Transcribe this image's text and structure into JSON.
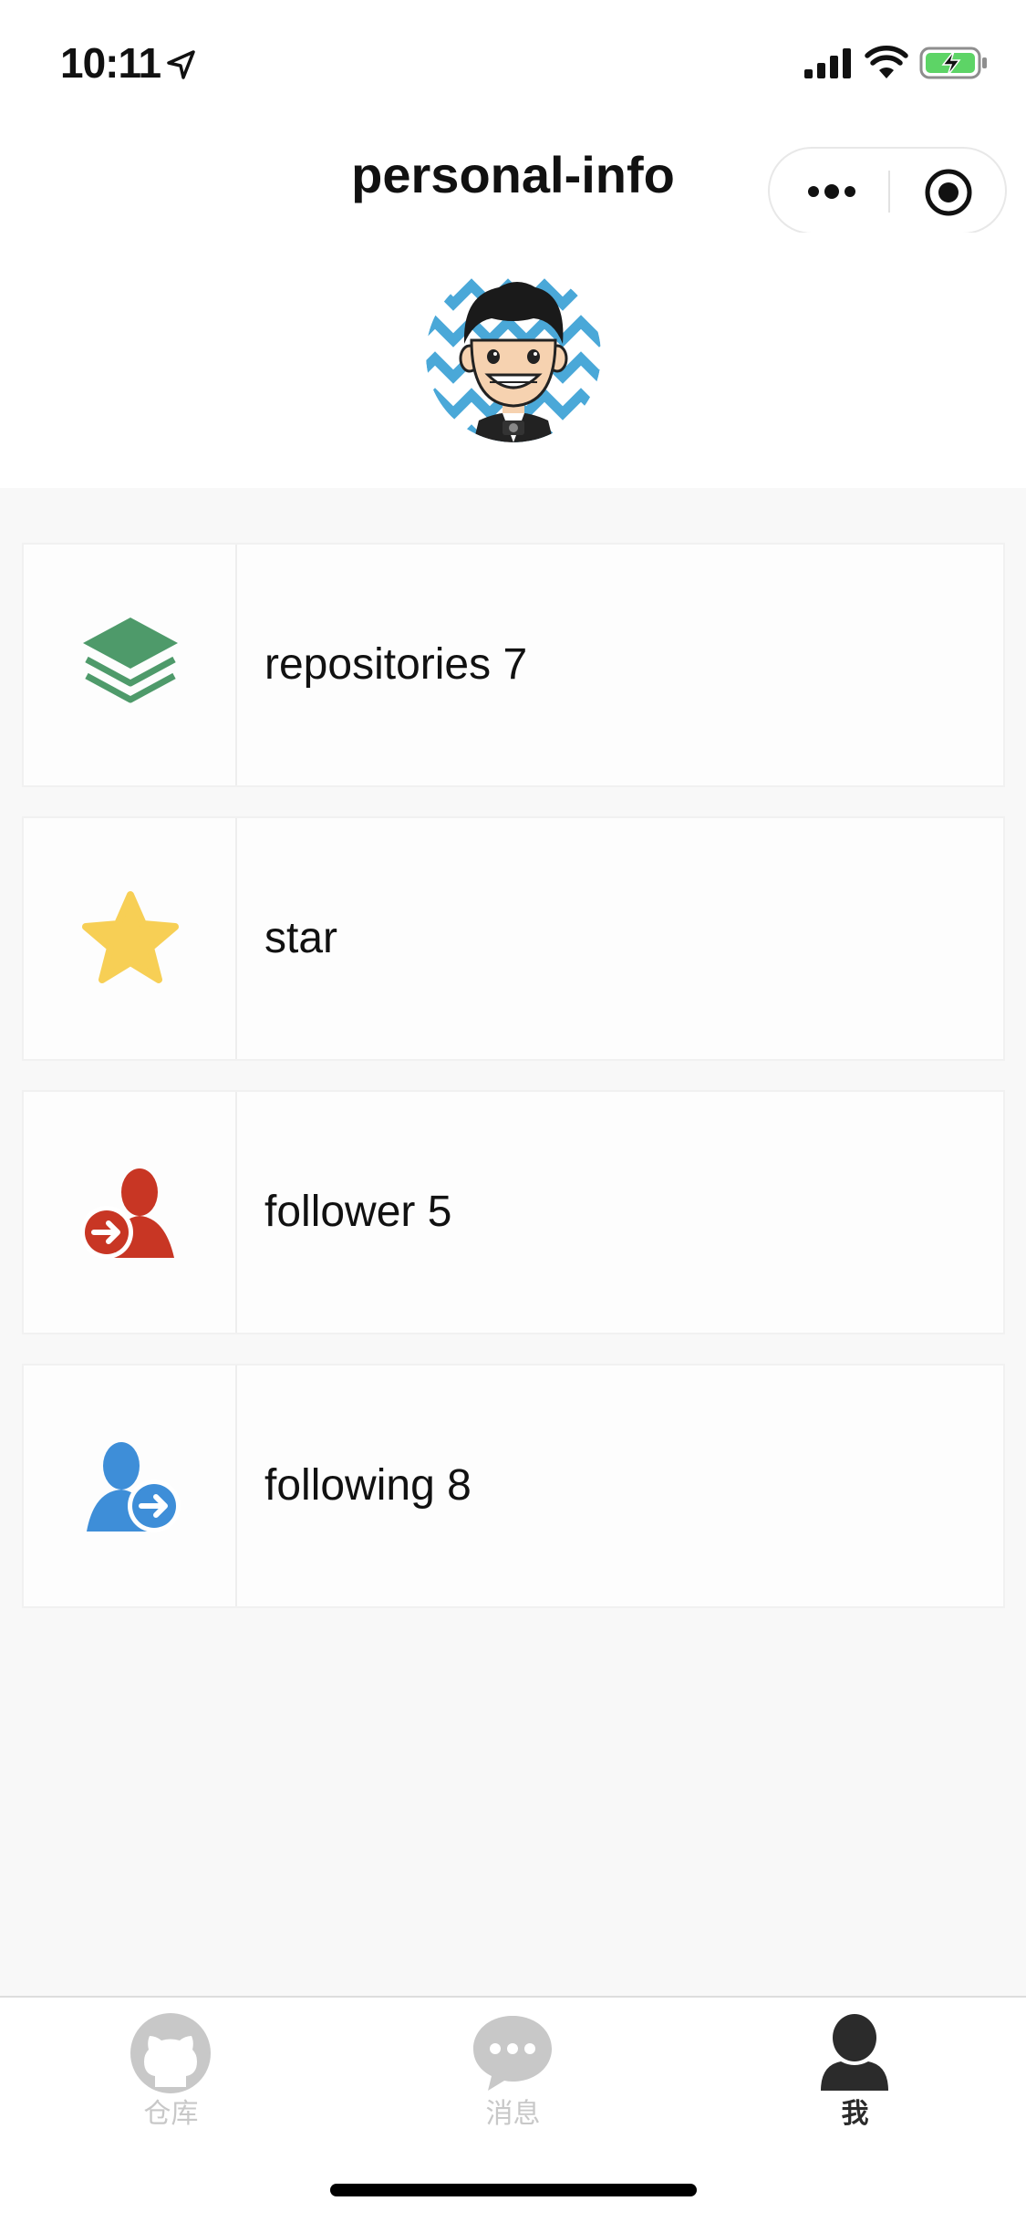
{
  "status_bar": {
    "time": "10:11",
    "icons": [
      "location-arrow-icon",
      "cellular-signal-icon",
      "wifi-icon",
      "battery-charging-icon"
    ]
  },
  "nav": {
    "title": "personal-info",
    "more_icon": "more-dots-icon",
    "close_icon": "miniprogram-close-icon"
  },
  "profile": {
    "avatar": "cartoon-avatar"
  },
  "menu": {
    "items": [
      {
        "icon": "repositories-stack-icon",
        "label": "repositories 7",
        "color": "#4e9a6a"
      },
      {
        "icon": "star-icon",
        "label": "star",
        "color": "#f7cf55"
      },
      {
        "icon": "follower-icon",
        "label": "follower 5",
        "color": "#c83624"
      },
      {
        "icon": "following-icon",
        "label": "following 8",
        "color": "#3e8ed8"
      }
    ]
  },
  "tab_bar": {
    "tabs": [
      {
        "icon": "github-octocat-icon",
        "label": "仓库",
        "active": false
      },
      {
        "icon": "chat-bubble-icon",
        "label": "消息",
        "active": false
      },
      {
        "icon": "user-icon",
        "label": "我",
        "active": true
      }
    ],
    "inactive_color": "#c8c8c8",
    "active_color": "#2b2b2b"
  }
}
